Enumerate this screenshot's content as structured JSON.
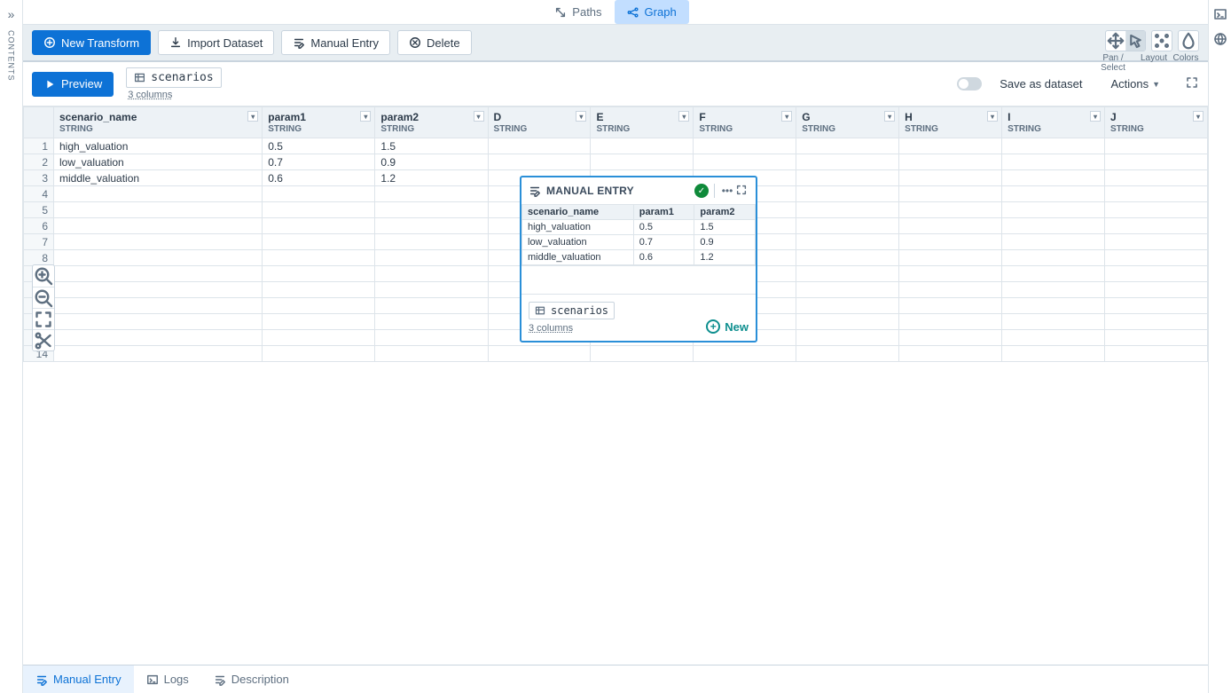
{
  "rail_left": {
    "label": "CONTENTS"
  },
  "top_tabs": {
    "paths": "Paths",
    "graph": "Graph"
  },
  "toolbar": {
    "new_transform": "New Transform",
    "import_dataset": "Import Dataset",
    "manual_entry": "Manual Entry",
    "delete": "Delete",
    "view_labels": {
      "pan_select": "Pan / Select",
      "layout": "Layout",
      "colors": "Colors"
    }
  },
  "node": {
    "title": "MANUAL ENTRY",
    "headers": [
      "scenario_name",
      "param1",
      "param2"
    ],
    "rows": [
      [
        "high_valuation",
        "0.5",
        "1.5"
      ],
      [
        "low_valuation",
        "0.7",
        "0.9"
      ],
      [
        "middle_valuation",
        "0.6",
        "1.2"
      ]
    ],
    "dataset_name": "scenarios",
    "columns_text": "3 columns",
    "new_label": "New"
  },
  "preview": {
    "button": "Preview",
    "dataset_name": "scenarios",
    "columns_text": "3 columns",
    "save_label": "Save as dataset",
    "actions_label": "Actions"
  },
  "grid": {
    "columns": [
      {
        "name": "scenario_name",
        "type": "STRING"
      },
      {
        "name": "param1",
        "type": "STRING"
      },
      {
        "name": "param2",
        "type": "STRING"
      },
      {
        "name": "D",
        "type": "STRING"
      },
      {
        "name": "E",
        "type": "STRING"
      },
      {
        "name": "F",
        "type": "STRING"
      },
      {
        "name": "G",
        "type": "STRING"
      },
      {
        "name": "H",
        "type": "STRING"
      },
      {
        "name": "I",
        "type": "STRING"
      },
      {
        "name": "J",
        "type": "STRING"
      }
    ],
    "rows": [
      [
        "high_valuation",
        "0.5",
        "1.5",
        "",
        "",
        "",
        "",
        "",
        "",
        ""
      ],
      [
        "low_valuation",
        "0.7",
        "0.9",
        "",
        "",
        "",
        "",
        "",
        "",
        ""
      ],
      [
        "middle_valuation",
        "0.6",
        "1.2",
        "",
        "",
        "",
        "",
        "",
        "",
        ""
      ]
    ],
    "total_rows": 14
  },
  "bottom_tabs": {
    "manual_entry": "Manual Entry",
    "logs": "Logs",
    "description": "Description"
  }
}
